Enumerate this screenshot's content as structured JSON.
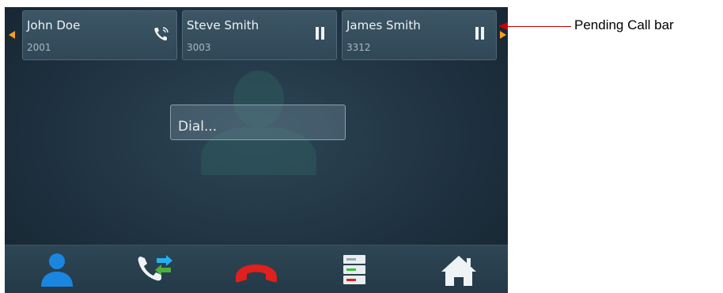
{
  "calls": [
    {
      "name": "John Doe",
      "extension": "2001",
      "status_icon": "call-active-icon"
    },
    {
      "name": "Steve Smith",
      "extension": "3003",
      "status_icon": "pause-icon"
    },
    {
      "name": "James Smith",
      "extension": "3312",
      "status_icon": "pause-icon"
    }
  ],
  "dial": {
    "placeholder": "Dial..."
  },
  "nav": {
    "items": [
      "contacts-icon",
      "transfer-call-icon",
      "hang-up-icon",
      "call-list-icon",
      "home-icon"
    ]
  },
  "annotation": {
    "label": "Pending Call bar"
  },
  "colors": {
    "accent_arrow": "#f5a11c",
    "hangup": "#e0201c",
    "contacts": "#1a86e0",
    "transfer": "#27b0f0",
    "annotation": "#cc0000"
  }
}
